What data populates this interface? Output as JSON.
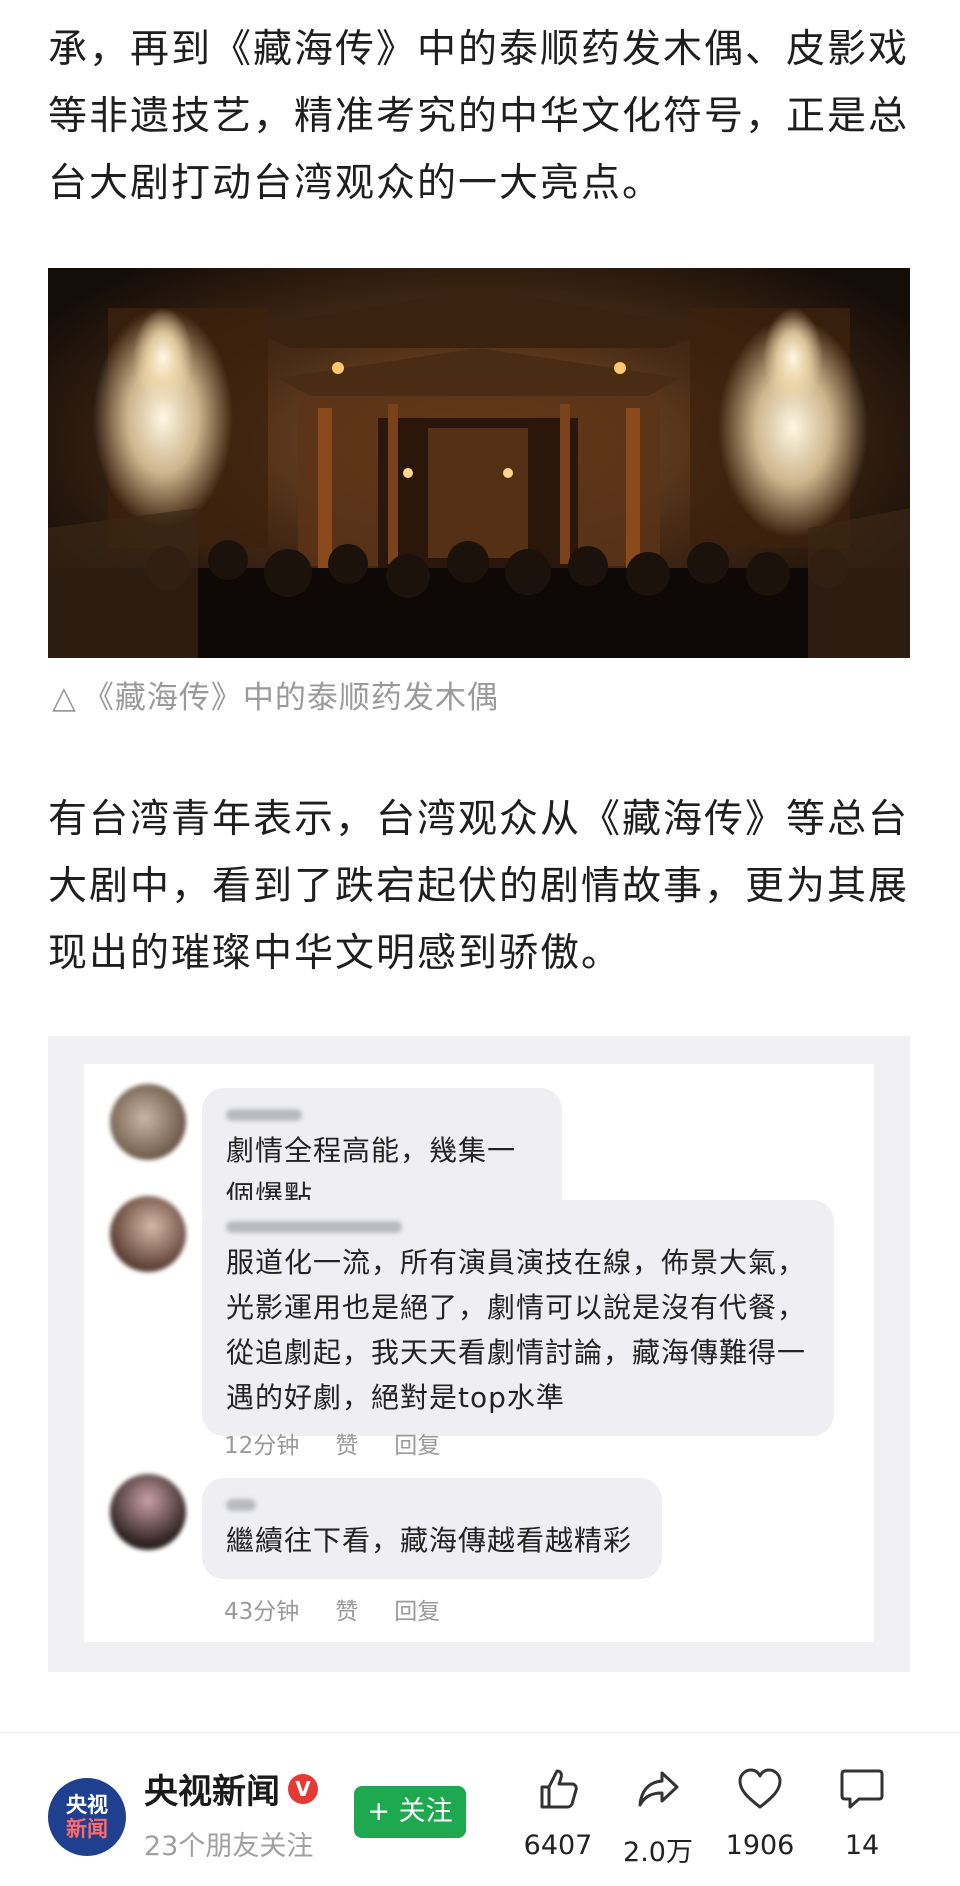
{
  "article": {
    "paragraph1": "承，再到《藏海传》中的泰顺药发木偶、皮影戏等非遗技艺，精准考究的中华文化符号，正是总台大剧打动台湾观众的一大亮点。",
    "image_caption_icon": "△",
    "image_caption": "《藏海传》中的泰顺药发木偶",
    "paragraph2": "有台湾青年表示，台湾观众从《藏海传》等总台大剧中，看到了跌宕起伏的剧情故事，更为其展现出的璀璨中华文明感到骄傲。"
  },
  "comments": [
    {
      "text": "劇情全程高能，幾集一個爆點"
    },
    {
      "text": "服道化一流，所有演員演技在線，佈景大氣，光影運用也是絕了，劇情可以說是沒有代餐，從追劇起，我天天看劇情討論，藏海傳難得一遇的好劇，絕對是top水準",
      "time": "12分钟",
      "like": "赞",
      "reply": "回复"
    },
    {
      "text": "繼續往下看，藏海傳越看越精彩",
      "time": "43分钟",
      "like": "赞",
      "reply": "回复"
    }
  ],
  "footer": {
    "logo_line1": "央视",
    "logo_line2": "新闻",
    "account_name": "央视新闻",
    "verified_badge": "V",
    "followers_text": "23个朋友关注",
    "follow_button": "+ 关注",
    "stats": [
      {
        "icon": "thumbs-up-icon",
        "value": "6407"
      },
      {
        "icon": "share-arrow-icon",
        "value": "2.0万"
      },
      {
        "icon": "heart-icon",
        "value": "1906"
      },
      {
        "icon": "comment-bubble-icon",
        "value": "14"
      }
    ]
  },
  "colors": {
    "follow_green": "#1ea84f",
    "logo_blue": "#1f3f8f",
    "verified_red": "#e53935",
    "caption_gray": "#9a9a9a"
  }
}
